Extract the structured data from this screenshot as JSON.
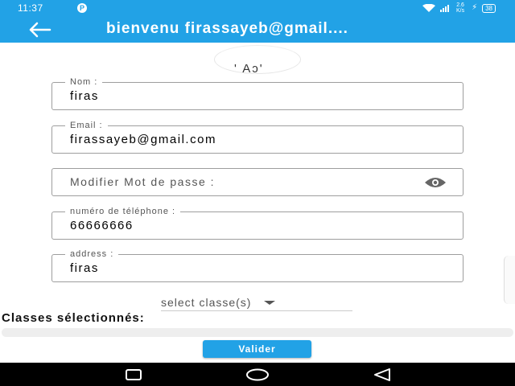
{
  "status_bar": {
    "time": "11:37",
    "app_badge": "P",
    "net_speed_top": "2.6",
    "net_speed_bottom": "K/s",
    "battery": "38"
  },
  "app_bar": {
    "back_icon": "arrow-left-icon",
    "title": "bienvenu firassayeb@gmail...."
  },
  "avatar": {
    "partial_text": "' Aɔ'"
  },
  "form": {
    "nom": {
      "label": "Nom :",
      "value": "firas"
    },
    "email": {
      "label": "Email :",
      "value": "firassayeb@gmail.com"
    },
    "password": {
      "placeholder": "Modifier Mot de passe :",
      "icon": "eye-icon"
    },
    "phone": {
      "label": "numéro de téléphone  :",
      "value": "66666666"
    },
    "address": {
      "label": "address  :",
      "value": "firas"
    }
  },
  "classes": {
    "select_label": "select classe(s)",
    "section_title": "Classes sélectionnés:"
  },
  "submit_label": "Valider",
  "colors": {
    "primary": "#22a2e6",
    "nav_bar": "#000000"
  }
}
